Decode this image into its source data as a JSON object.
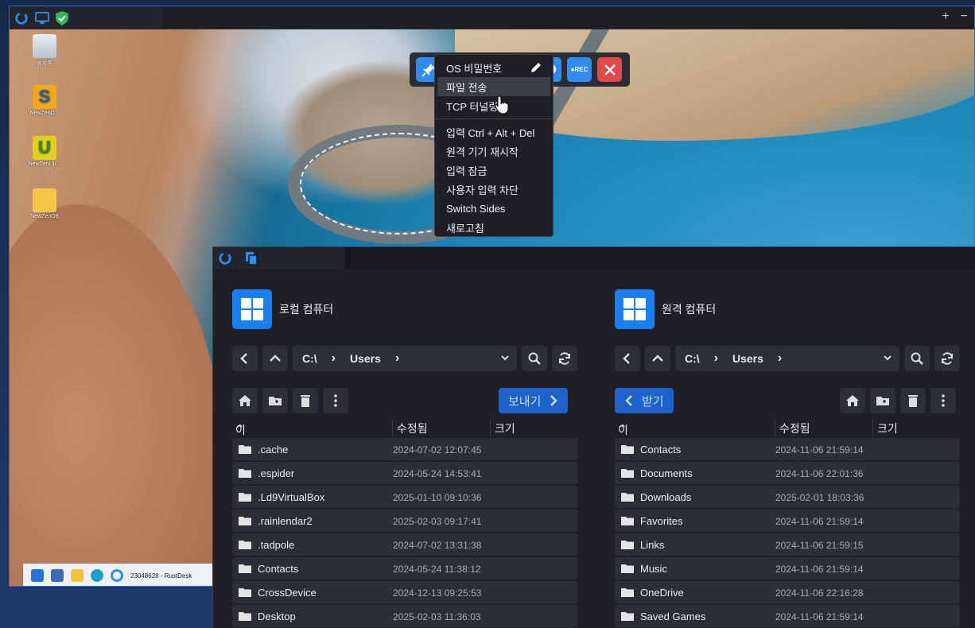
{
  "toolbar": {
    "buttons": [
      "pin-icon",
      "lightning-icon",
      "monitor-icon",
      "keyboard-icon",
      "chat-icon",
      "rec-icon",
      "close-icon"
    ],
    "rec_label": "●REC"
  },
  "menu": {
    "items": [
      {
        "label": "OS 비밀번호",
        "icon": "pencil-icon"
      },
      {
        "label": "파일 전송",
        "highlight": true
      },
      {
        "label": "TCP 터널링"
      },
      {
        "sep": true
      },
      {
        "label": "입력 Ctrl + Alt + Del"
      },
      {
        "label": "원격 기기 재시작"
      },
      {
        "label": "입력 잠금"
      },
      {
        "label": "사용자 입력 차단"
      },
      {
        "label": "Switch Sides"
      },
      {
        "label": "새로고침"
      }
    ]
  },
  "remote_desktop": {
    "icons": [
      {
        "label": "휴지통"
      },
      {
        "label": "NewZenD..."
      },
      {
        "label": "NewZenUp..."
      },
      {
        "label": "NewZenDB"
      }
    ],
    "taskbar_label": "23048628 - RustDesk"
  },
  "titlebar": {
    "plus": "+",
    "minus": "−"
  },
  "left": {
    "title": "로컬 컴퓨터",
    "path": [
      "C:\\",
      "Users"
    ],
    "send_label": "보내기",
    "columns": {
      "name": "이름",
      "modified": "수정됨",
      "size": "크기"
    },
    "rows": [
      {
        "name": ".cache",
        "date": "2024-07-02 12:07:45"
      },
      {
        "name": ".espider",
        "date": "2024-05-24 14:53:41"
      },
      {
        "name": ".Ld9VirtualBox",
        "date": "2025-01-10 09:10:36"
      },
      {
        "name": ".rainlendar2",
        "date": "2025-02-03 09:17:41"
      },
      {
        "name": ".tadpole",
        "date": "2024-07-02 13:31:38"
      },
      {
        "name": "Contacts",
        "date": "2024-05-24 11:38:12"
      },
      {
        "name": "CrossDevice",
        "date": "2024-12-13 09:25:53"
      },
      {
        "name": "Desktop",
        "date": "2025-02-03 11:36:03"
      }
    ]
  },
  "right": {
    "title": "원격 컴퓨터",
    "path": [
      "C:\\",
      "Users"
    ],
    "receive_label": "받기",
    "columns": {
      "name": "이름",
      "modified": "수정됨",
      "size": "크기"
    },
    "rows": [
      {
        "name": "Contacts",
        "date": "2024-11-06 21:59:14"
      },
      {
        "name": "Documents",
        "date": "2024-11-06 22:01:36"
      },
      {
        "name": "Downloads",
        "date": "2025-02-01 18:03:36"
      },
      {
        "name": "Favorites",
        "date": "2024-11-06 21:59:14"
      },
      {
        "name": "Links",
        "date": "2024-11-06 21:59:15"
      },
      {
        "name": "Music",
        "date": "2024-11-06 21:59:14"
      },
      {
        "name": "OneDrive",
        "date": "2024-11-06 22:16:28"
      },
      {
        "name": "Saved Games",
        "date": "2024-11-06 21:59:14"
      }
    ]
  },
  "colors": {
    "accent": "#2f8cf2",
    "close": "#e54848",
    "send": "#1d62c8"
  }
}
